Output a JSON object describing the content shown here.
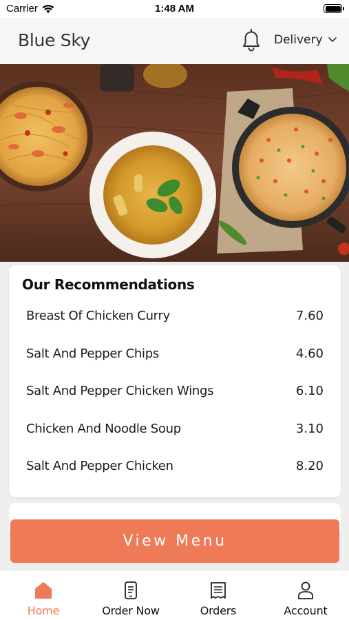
{
  "status_bar": {
    "carrier": "Carrier",
    "time": "1:48 AM"
  },
  "header": {
    "title": "Blue Sky",
    "icons": [
      "bell-icon",
      "chevron-down-icon"
    ],
    "delivery_label": "Delivery"
  },
  "recommendations": {
    "title": "Our Recommendations",
    "items": [
      {
        "name": "Breast Of Chicken Curry",
        "price": "7.60"
      },
      {
        "name": "Salt And Pepper Chips",
        "price": "4.60"
      },
      {
        "name": "Salt And Pepper Chicken Wings",
        "price": "6.10"
      },
      {
        "name": "Chicken And Noodle Soup",
        "price": "3.10"
      },
      {
        "name": "Salt And Pepper Chicken",
        "price": "8.20"
      }
    ]
  },
  "view_menu_label": "View Menu",
  "bottom_nav": [
    {
      "label": "Home",
      "icon": "home-icon",
      "active": true
    },
    {
      "label": "Order Now",
      "icon": "phone-order-icon",
      "active": false
    },
    {
      "label": "Orders",
      "icon": "receipt-icon",
      "active": false
    },
    {
      "label": "Account",
      "icon": "user-icon",
      "active": false
    }
  ],
  "colors": {
    "accent": "#ee7a58",
    "background": "#efefef",
    "header": "#f6f6f6"
  }
}
